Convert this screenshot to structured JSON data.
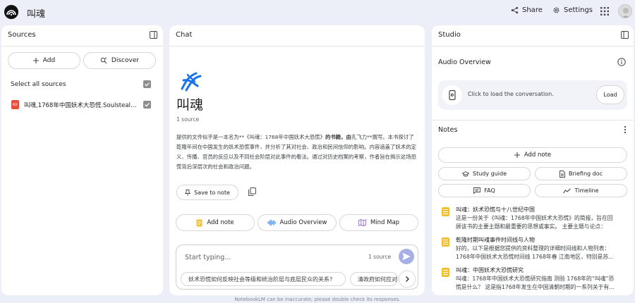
{
  "app": {
    "notebook_title": "叫魂",
    "share_label": "Share",
    "settings_label": "Settings"
  },
  "sources": {
    "title": "Sources",
    "add_label": "Add",
    "discover_label": "Discover",
    "select_all_label": "Select all sources",
    "items": [
      {
        "name": "叫魂,1768年中国妖术大恐慌.Soulstealers,...",
        "type_badge": "PDF"
      }
    ]
  },
  "chat": {
    "title": "Chat",
    "book_title": "叫魂",
    "source_count": "1 source",
    "summary": {
      "p1": "提供的文件似乎是一本名为**《叫魂：1768年中国妖术大恐慌》",
      "p1_bold": "的书籍，由",
      "p1_after": "孔飞力**撰写。本书探讨了乾隆年间在中国发生的妖术恐慌事件，并分析了其对社会、政治和民间信仰的影响。内容涵盖了妖术的定义、传播、官员的反应以及不同社会阶层对此事件的看法。通过对历史档案的考察，作者旨在揭示这场恐慌背后深层次的社会和政治问题。"
    },
    "save_to_note_label": "Save to note",
    "actions": [
      {
        "label": "Add note"
      },
      {
        "label": "Audio Overview"
      },
      {
        "label": "Mind Map"
      }
    ],
    "input_placeholder": "Start typing...",
    "input_source_count": "1 source",
    "suggestions": [
      "妖术恐慌如何反映社会等级和统治阶层与底层民众的关系?",
      "清政府如何应对"
    ],
    "footer_note": "NotebookLM can be inaccurate; please double check its responses."
  },
  "studio": {
    "title": "Studio",
    "audio_overview_title": "Audio Overview",
    "audio_card_text": "Click to load the conversation.",
    "load_label": "Load",
    "notes_title": "Notes",
    "add_note_label": "Add note",
    "tools": [
      {
        "label": "Study guide"
      },
      {
        "label": "Briefing doc"
      },
      {
        "label": "FAQ"
      },
      {
        "label": "Timeline"
      }
    ],
    "notes": [
      {
        "title": "叫魂：妖术恐慌与十八世纪中国",
        "line1": "这是一份关于《叫魂：1768年中国妖术大恐慌》的简报，旨在回",
        "line2": "顾该书的主要主题和最重要的思想或事实。 主要主题与论点："
      },
      {
        "title": "乾隆时期叫魂事件时间线与人物",
        "line1": "好的，以下是根据您提供的资料整理的详细时间线和人物列表：",
        "line2": "1768年中国妖术大恐慌时间线 1768年春 江南地区，特别是苏..."
      },
      {
        "title": "叫魂：中国妖术大恐慌研究",
        "line1": "叫魂：1768年中国妖术大恐慌研究指南 测验 1768年的“叫魂”恐",
        "line2": "慌是什么？ 这是指1768年发生在中国清朝时期的一系列关于有..."
      }
    ]
  },
  "colors": {
    "background": "#eceef8",
    "panel": "#ffffff",
    "knot_blue": "#1a73e8",
    "send_button": "#a7b0e6",
    "note_icon": "#f0c02e",
    "pdf_badge": "#e44c3c"
  },
  "icons": [
    "notebooklm-logo-icon",
    "share-icon",
    "gear-icon",
    "apps-grid-icon",
    "panel-collapse-icon",
    "plus-icon",
    "discover-icon",
    "check-icon",
    "pdf-icon",
    "knot-icon",
    "pin-icon",
    "copy-icon",
    "note-add-icon",
    "audio-waveform-icon",
    "mind-map-icon",
    "send-icon",
    "chevron-right-icon",
    "info-icon",
    "more-vert-icon",
    "phone-audio-icon",
    "study-guide-icon",
    "briefing-doc-icon",
    "faq-icon",
    "timeline-icon",
    "note-icon"
  ]
}
